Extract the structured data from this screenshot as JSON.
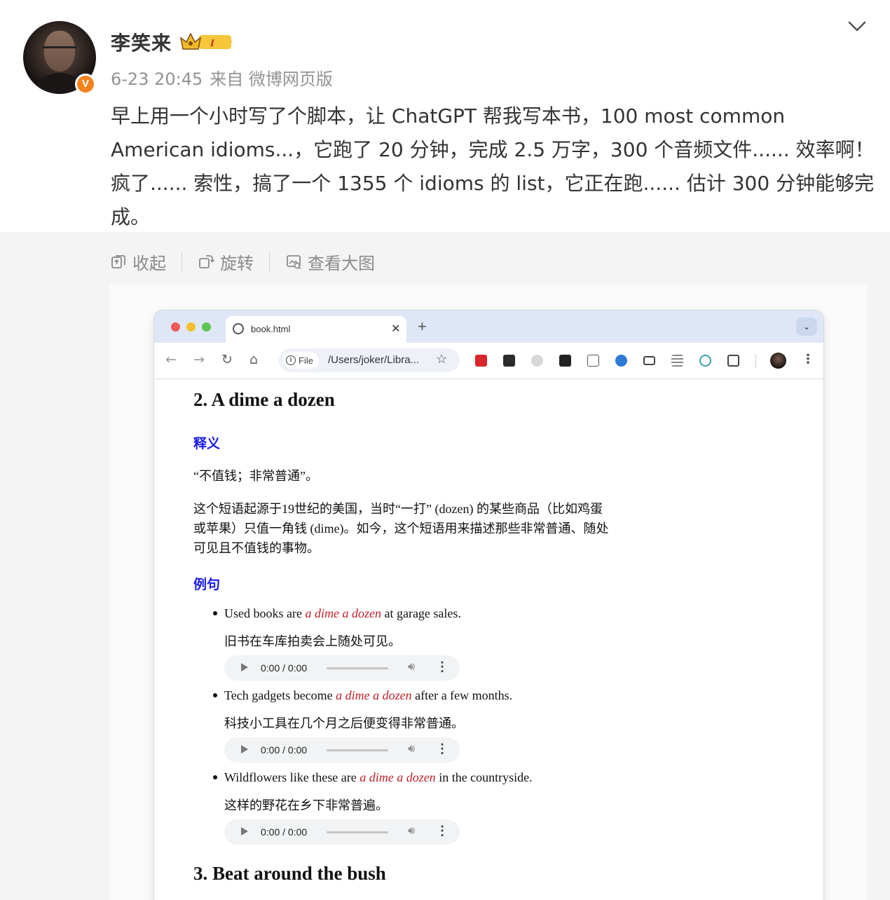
{
  "post": {
    "author": "李笑来",
    "level_badge": "I",
    "verified_badge": "V",
    "time": "6-23 20:45",
    "source": "来自 微博网页版",
    "text": "早上用一个小时写了个脚本，让 ChatGPT 帮我写本书，100 most common American idioms...，它跑了 20 分钟，完成 2.5 万字，300 个音频文件...... 效率啊！疯了...... 索性，搞了一个 1355 个 idioms 的 list，它正在跑...... 估计 300 分钟能够完成。"
  },
  "media_toolbar": {
    "collapse": "收起",
    "rotate": "旋转",
    "view_large": "查看大图"
  },
  "browser": {
    "tab_title": "book.html",
    "tab_close": "✕",
    "new_tab": "+",
    "tab_menu": "⌄",
    "omnibox_scheme": "File",
    "omnibox_url": "/Users/joker/Libra...",
    "back": "←",
    "forward": "→",
    "reload": "↻",
    "home": "⌂",
    "star": "☆",
    "kebab": "⋮"
  },
  "page": {
    "section2": {
      "heading": "2. A dime a dozen",
      "meaning_label": "释义",
      "meaning": "“不值钱；非常普通”。",
      "origin_line1": "这个短语起源于19世纪的美国，当时“一打” (dozen) 的某些商品（比如鸡蛋",
      "origin_line2": "或苹果）只值一角钱 (dime)。如今，这个短语用来描述那些非常普通、随处",
      "origin_line3": "可见且不值钱的事物。",
      "examples_label": "例句",
      "examples": [
        {
          "before": "Used books are ",
          "idiom": "a dime a dozen",
          "after": " at garage sales.",
          "translation": "旧书在车库拍卖会上随处可见。",
          "audio_time": "0:00 / 0:00"
        },
        {
          "before": "Tech gadgets become ",
          "idiom": "a dime a dozen",
          "after": " after a few months.",
          "translation": "科技小工具在几个月之后便变得非常普通。",
          "audio_time": "0:00 / 0:00"
        },
        {
          "before": "Wildflowers like these are ",
          "idiom": "a dime a dozen",
          "after": " in the countryside.",
          "translation": "这样的野花在乡下非常普遍。",
          "audio_time": "0:00 / 0:00"
        }
      ]
    },
    "section3": {
      "heading": "3. Beat around the bush"
    }
  },
  "colors": {
    "accent_orange": "#f5821f",
    "heading_blue": "#1a1ae8",
    "idiom_red": "#c0202a",
    "meta_gray": "#939393"
  },
  "icons": [
    "chevron-down-icon",
    "collapse-icon",
    "rotate-icon",
    "view-large-icon",
    "globe-icon",
    "info-icon",
    "star-icon",
    "profile-icon",
    "kebab-icon",
    "play-icon",
    "volume-icon"
  ]
}
